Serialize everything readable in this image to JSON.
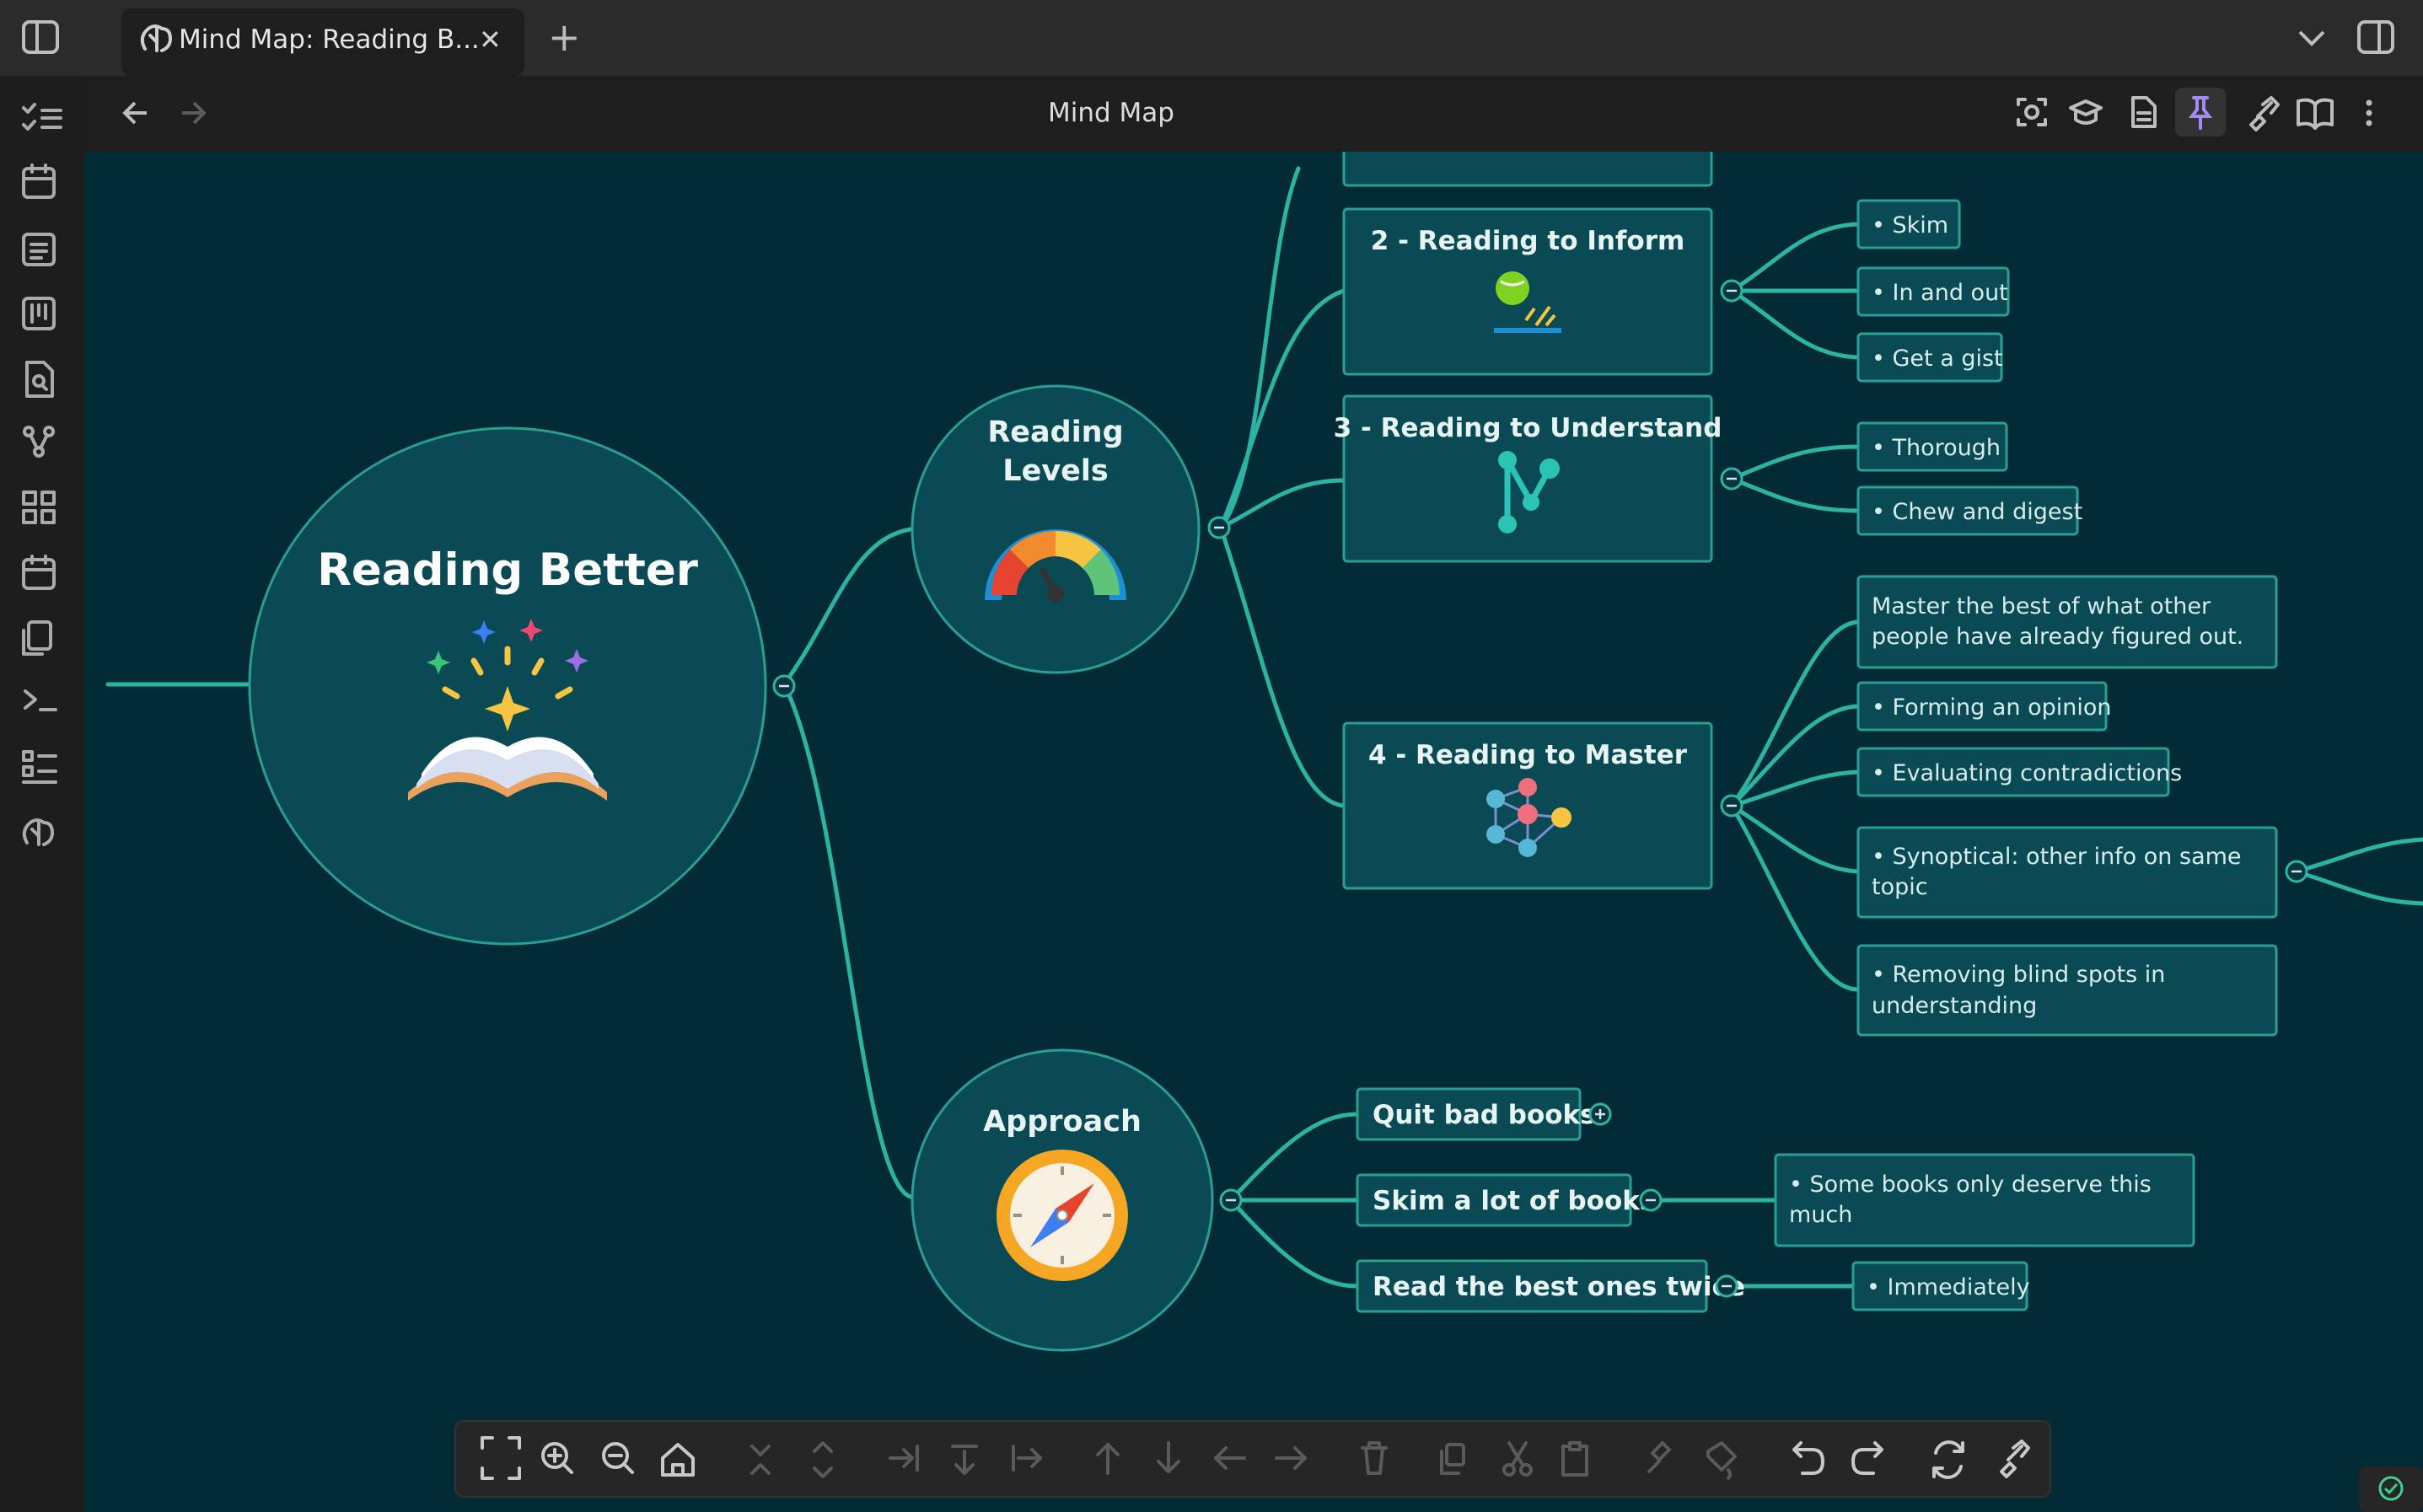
{
  "tab": {
    "title": "Mind Map: Reading B...",
    "close": "✕",
    "new": "+"
  },
  "header": {
    "title": "Mind Map"
  },
  "root": {
    "title": "Reading Better"
  },
  "levels": {
    "title_line1": "Reading",
    "title_line2": "Levels",
    "inform": {
      "title": "2 - Reading to Inform",
      "items": [
        "• Skim",
        "• In and out",
        "• Get a gist"
      ]
    },
    "understand": {
      "title": "3 - Reading to Understand",
      "items": [
        "• Thorough",
        "• Chew and digest"
      ]
    },
    "master": {
      "title": "4 - Reading to Master",
      "items": [
        {
          "line1": "Master the best of what other",
          "line2": "people have already figured out."
        },
        {
          "line1": "• Forming an opinion"
        },
        {
          "line1": "• Evaluating contradictions"
        },
        {
          "line1": "• Synoptical: other info on same",
          "line2": "topic"
        },
        {
          "line1": "• Removing blind spots in",
          "line2": "understanding"
        }
      ]
    }
  },
  "approach": {
    "title": "Approach",
    "quit": "Quit bad books",
    "skim": "Skim a lot of books",
    "skim_note_line1": "• Some books only deserve this",
    "skim_note_line2": "much",
    "read": "Read the best ones twice",
    "read_note": "• Immediately"
  },
  "colors": {
    "canvas": "#032b36",
    "node": "#0a4a55",
    "node_stroke": "#2a9d94",
    "branch": "#2bb3a3",
    "chrome": "#262626",
    "sidebar": "#1d1d1d"
  }
}
